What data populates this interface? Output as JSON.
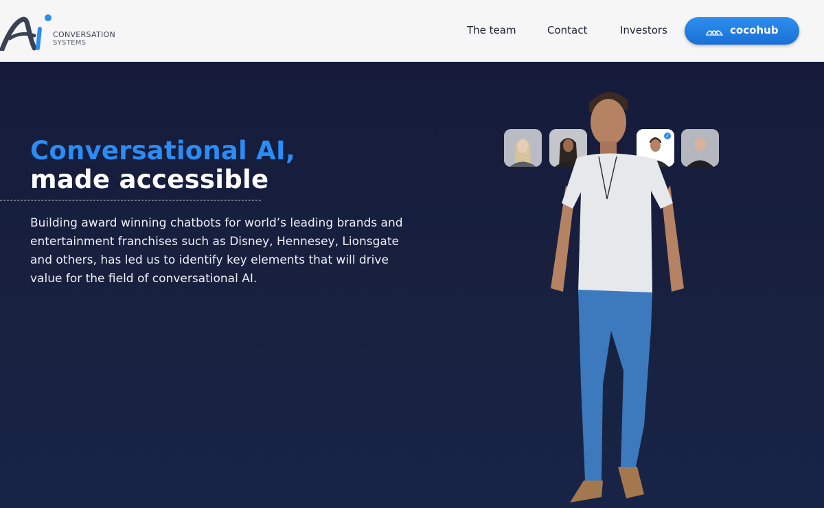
{
  "brand": {
    "line1": "CONVERSATION",
    "line2": "SYSTEMS",
    "color": "#2b8cf4",
    "icon": "ai-logo-icon"
  },
  "nav": {
    "items": [
      {
        "label": "The team"
      },
      {
        "label": "Contact"
      },
      {
        "label": "Investors"
      }
    ],
    "cta": {
      "label": "cocohub",
      "icon": "cocohub-logo-icon",
      "color": "#1f7de0"
    }
  },
  "hero": {
    "headline_accent": "Conversational AI,",
    "headline_rest": "made accessible",
    "description": "Building award winning chatbots for world’s leading brands and entertainment franchises such as Disney, Hennesey, Lionsgate and others, has led us to identify key elements that will drive value for the field of conversational AI.",
    "accent_color": "#2b8cf4",
    "background": "#18203f"
  },
  "avatars": [
    {
      "name": "avatar-blonde-woman",
      "selected": false
    },
    {
      "name": "avatar-dark-hair-woman",
      "selected": false
    },
    {
      "name": "avatar-brown-hair-man",
      "selected": true
    },
    {
      "name": "avatar-bald-man",
      "selected": false
    }
  ]
}
